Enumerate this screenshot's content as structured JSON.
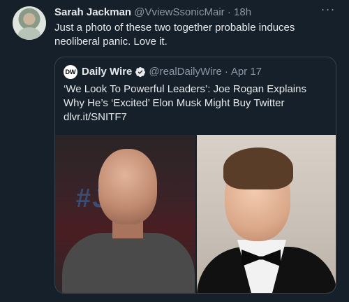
{
  "tweet": {
    "author_name": "Sarah Jackman",
    "author_handle": "@VviewSsonicMair",
    "separator": "·",
    "timestamp": "18h",
    "text": "Just a photo of these two together probable induces neoliberal panic. Love it.",
    "more_icon": "more-horizontal-icon"
  },
  "quote": {
    "logo_text": "DW",
    "author_name": "Daily Wire",
    "verified_icon": "verified-badge-icon",
    "author_handle": "@realDailyWire",
    "separator": "·",
    "timestamp": "Apr 17",
    "text": "‘We Look To Powerful Leaders’: Joe Rogan Explains Why He’s ‘Excited’ Elon Musk Might Buy Twitter",
    "link": "dlvr.it/SNITF7",
    "images": [
      "photo-left",
      "photo-right"
    ]
  },
  "colors": {
    "background": "#15202b",
    "border": "#38444d",
    "text_primary": "#e7e9ea",
    "text_secondary": "#8b98a5",
    "verified": "#1d9bf0"
  }
}
